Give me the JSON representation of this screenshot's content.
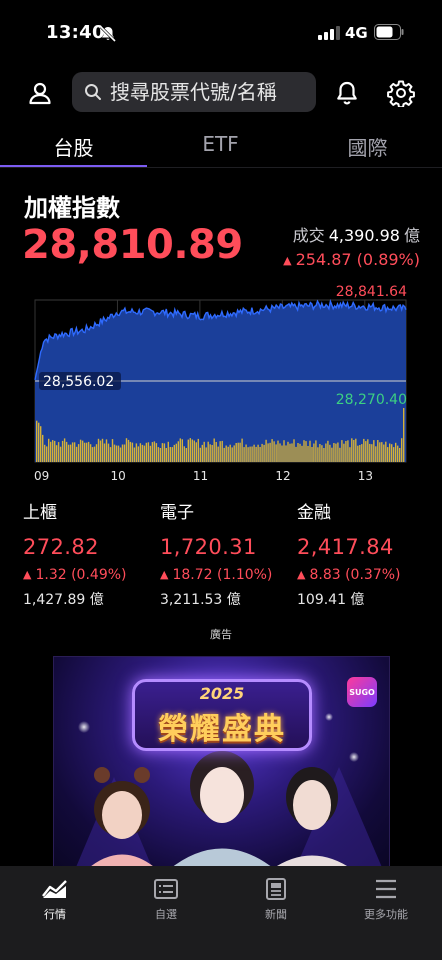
{
  "status_bar": {
    "time": "13:40",
    "network": "4G"
  },
  "header": {
    "search_placeholder": "搜尋股票代號/名稱"
  },
  "tabs": [
    {
      "label": "台股",
      "active": true
    },
    {
      "label": "ETF",
      "active": false
    },
    {
      "label": "國際",
      "active": false
    }
  ],
  "index": {
    "title": "加權指數",
    "value": "28,810.89",
    "volume_label": "成交",
    "volume_value": "4,390.98",
    "volume_unit": "億",
    "change": "254.87 (0.89%)"
  },
  "chart_data": {
    "type": "area",
    "high_label": "28,841.64",
    "reference_label": "28,556.02",
    "low_label": "28,270.40",
    "x_ticks": [
      "09",
      "10",
      "11",
      "12",
      "13"
    ],
    "ylim": [
      28270.4,
      28841.64
    ],
    "reference": 28556.02,
    "price_series": [
      {
        "t": 9.0,
        "v": 28560
      },
      {
        "t": 9.1,
        "v": 28700
      },
      {
        "t": 9.3,
        "v": 28720
      },
      {
        "t": 9.6,
        "v": 28735
      },
      {
        "t": 9.9,
        "v": 28780
      },
      {
        "t": 10.0,
        "v": 28800
      },
      {
        "t": 10.5,
        "v": 28800
      },
      {
        "t": 11.0,
        "v": 28785
      },
      {
        "t": 11.5,
        "v": 28800
      },
      {
        "t": 12.0,
        "v": 28815
      },
      {
        "t": 12.5,
        "v": 28825
      },
      {
        "t": 13.0,
        "v": 28820
      },
      {
        "t": 13.5,
        "v": 28810
      }
    ],
    "colors": {
      "price": "#2f6bff",
      "fill": "#1b3f9a",
      "volume": "#d4b13a",
      "high": "#ff4d5a",
      "low": "#3ccf83"
    }
  },
  "sub_indices": [
    {
      "name": "上櫃",
      "value": "272.82",
      "change": "1.32 (0.49%)",
      "volume": "1,427.89 億"
    },
    {
      "name": "電子",
      "value": "1,720.31",
      "change": "18.72 (1.10%)",
      "volume": "3,211.53 億"
    },
    {
      "name": "金融",
      "value": "2,417.84",
      "change": "8.83 (0.37%)",
      "volume": "109.41 億"
    }
  ],
  "ad": {
    "label": "廣告",
    "year": "2025",
    "title": "榮耀盛典",
    "brand": "SUGO"
  },
  "bottom_nav": [
    {
      "label": "行情",
      "icon": "chart-icon",
      "active": true
    },
    {
      "label": "自選",
      "icon": "watchlist-icon",
      "active": false
    },
    {
      "label": "新聞",
      "icon": "news-icon",
      "active": false
    },
    {
      "label": "更多功能",
      "icon": "menu-icon",
      "active": false
    }
  ],
  "accent_color": "#7c5cf2",
  "up_color": "#ff4d5a"
}
